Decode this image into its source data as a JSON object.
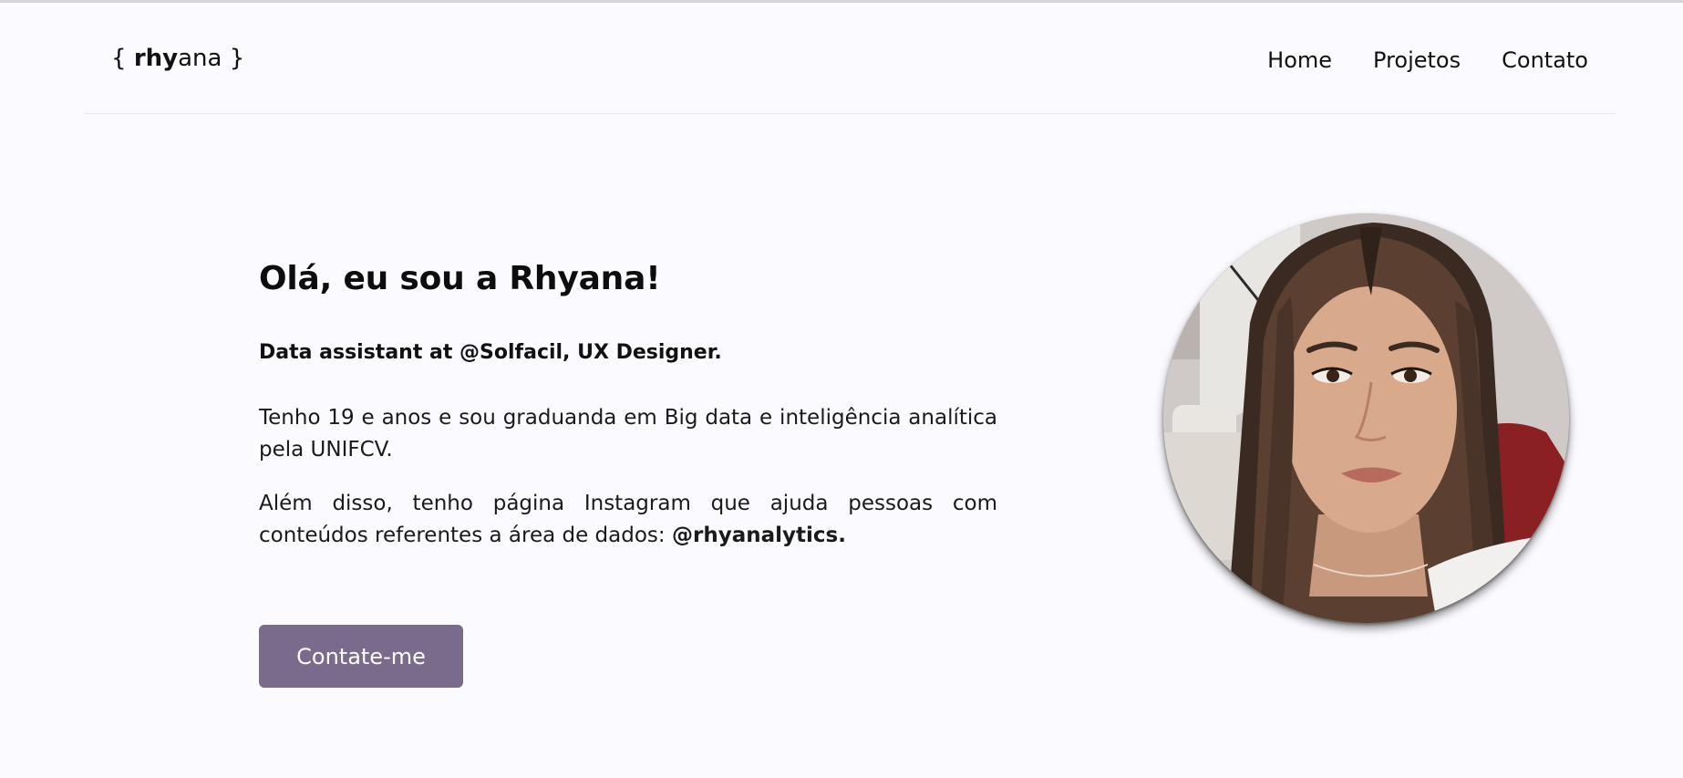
{
  "header": {
    "logo": {
      "open_brace": "{",
      "bold": "rhy",
      "light": "ana",
      "close_brace": "}"
    },
    "nav": [
      {
        "label": "Home"
      },
      {
        "label": "Projetos"
      },
      {
        "label": "Contato"
      }
    ]
  },
  "hero": {
    "title": "Olá, eu sou a Rhyana!",
    "subtitle": "Data assistant at @Solfacil, UX Designer.",
    "paragraph1": "Tenho 19 e anos e sou graduanda em Big data e inteligência analítica pela UNIFCV.",
    "paragraph2_text": "Além disso, tenho página Instagram que ajuda pessoas com conteúdos referentes a área de dados: ",
    "paragraph2_handle": "@rhyanalytics.",
    "cta_label": "Contate-me"
  },
  "colors": {
    "background": "#fbfaff",
    "cta_background": "#7a6a8b",
    "cta_text": "#ffffff"
  }
}
